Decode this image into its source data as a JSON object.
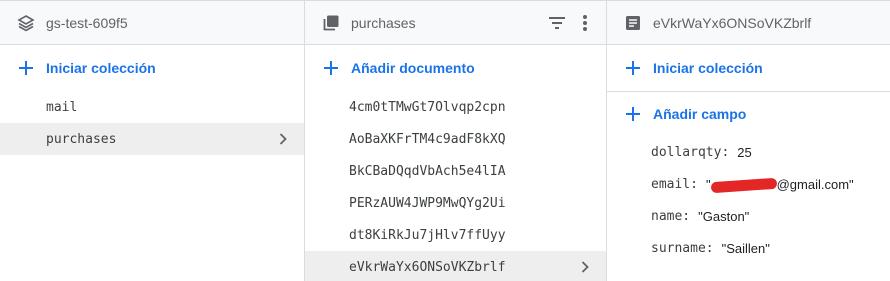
{
  "panel_root": {
    "title": "gs-test-609f5",
    "add_label": "Iniciar colección",
    "collections": [
      "mail",
      "purchases"
    ],
    "selected_index": 1
  },
  "panel_collection": {
    "title": "purchases",
    "add_label": "Añadir documento",
    "documents": [
      "4cm0tTMwGt7Olvqp2cpn",
      "AoBaXKFrTM4c9adF8kXQ",
      "BkCBaDQqdVbAch5e4lIA",
      "PERzAUW4JWP9MwQYg2Ui",
      "dt8KiRkJu7jHlv7ffUyy",
      "eVkrWaYx6ONSoVKZbrlf"
    ],
    "selected_index": 5
  },
  "panel_document": {
    "title": "eVkrWaYx6ONSoVKZbrlf",
    "add_collection_label": "Iniciar colección",
    "add_field_label": "Añadir campo",
    "fields": [
      {
        "key": "dollarqty:",
        "value": "25"
      },
      {
        "key": "email:",
        "value_prefix": "\"",
        "value_suffix": "@gmail.com\""
      },
      {
        "key": "name:",
        "value": "\"Gaston\""
      },
      {
        "key": "surname:",
        "value": "\"Saillen\""
      }
    ]
  },
  "colors": {
    "accent": "#1a73e8",
    "redaction": "#e32626",
    "selected_bg": "#eeeeee"
  },
  "icons": {
    "root": "stack-icon",
    "collection": "collection-icon",
    "document": "document-icon",
    "filter": "filter-icon",
    "more": "more-vert-icon",
    "add": "plus-icon",
    "chevron": "chevron-right-icon"
  }
}
